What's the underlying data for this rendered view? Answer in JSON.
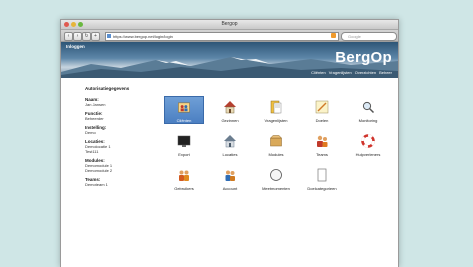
{
  "window": {
    "title": "Bergop"
  },
  "toolbar": {
    "url": "https://www.bergop.net/login/login",
    "search_placeholder": "Google"
  },
  "header": {
    "login_link": "Inloggen",
    "brand": "BergOp",
    "nav": [
      "Cliënten",
      "Vragenlijsten",
      "Overzichten",
      "Beheer"
    ]
  },
  "sidebar": {
    "heading": "Autorisatiegegevens",
    "fields": [
      {
        "label": "Naam:",
        "values": [
          "Jan Jansen"
        ]
      },
      {
        "label": "Functie:",
        "values": [
          "Beheerder"
        ]
      },
      {
        "label": "Instelling:",
        "values": [
          "Demo"
        ]
      },
      {
        "label": "Locaties:",
        "values": [
          "Demolocatie 1",
          "Test111"
        ]
      },
      {
        "label": "Modules:",
        "values": [
          "Demomodule 1",
          "Demomodule 2"
        ]
      },
      {
        "label": "Teams:",
        "values": [
          "Demoteam 1"
        ]
      }
    ]
  },
  "tiles": [
    {
      "label": "Cliënten",
      "icon": "clients-icon",
      "selected": true
    },
    {
      "label": "Gezinnen",
      "icon": "house-family-icon"
    },
    {
      "label": "Vragenlijsten",
      "icon": "questionnaire-icon"
    },
    {
      "label": "Doelen",
      "icon": "pencil-note-icon"
    },
    {
      "label": "Monitoring",
      "icon": "magnifier-icon"
    },
    {
      "label": "Export",
      "icon": "export-monitor-icon"
    },
    {
      "label": "Locaties",
      "icon": "location-house-icon"
    },
    {
      "label": "Modules",
      "icon": "box-modules-icon"
    },
    {
      "label": "Teams",
      "icon": "teams-icon"
    },
    {
      "label": "Hulpverleners",
      "icon": "lifebuoy-icon"
    },
    {
      "label": "Gebruikers",
      "icon": "users-icon"
    },
    {
      "label": "Account",
      "icon": "account-icon"
    },
    {
      "label": "Meetmomenten",
      "icon": "clock-icon"
    },
    {
      "label": "Doelcategorieen",
      "icon": "document-icon"
    }
  ],
  "colors": {
    "page_bg": "#cfe6e6",
    "accent": "#4b7fc2",
    "banner": "#2e5677"
  }
}
